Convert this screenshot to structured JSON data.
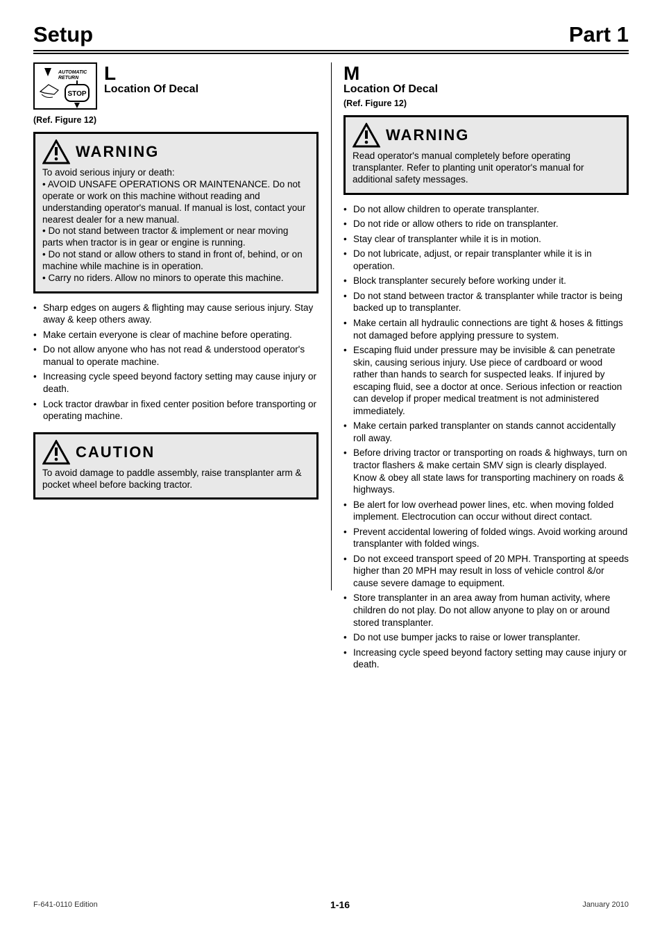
{
  "header": {
    "left": "Setup",
    "right": "Part 1"
  },
  "left_col": {
    "section_title": "L",
    "section_sub": "Location Of Decal",
    "ref": "(Ref. Figure 12)",
    "warn1_title": "WARNING",
    "warn1_body": "To avoid serious injury or death:\n• AVOID UNSAFE OPERATIONS OR MAINTENANCE. Do not operate or work on this machine without reading and understanding operator's manual. If manual is lost, contact your nearest dealer for a new manual.\n• Do not stand between tractor & implement or near moving parts when tractor is in gear or engine is running.\n• Do not stand or allow others to stand in front of, behind, or on machine while machine is in operation.\n• Carry no riders. Allow no minors to operate this machine.",
    "bullet_1": "Sharp edges on augers & flighting may cause serious injury. Stay away & keep others away.",
    "bullet_2": "Make certain everyone is clear of machine before operating.",
    "bullet_3": "Do not allow anyone who has not read & understood operator's manual to operate machine.",
    "bullet_4": "Increasing cycle speed beyond factory setting may cause injury or death.",
    "bullet_5": "Lock tractor drawbar in fixed center position before transporting or operating machine.",
    "warn2_title": "CAUTION",
    "warn2_body": "To avoid damage to paddle assembly, raise transplanter arm & pocket wheel before backing tractor."
  },
  "right_col": {
    "section_title": "M",
    "section_sub": "Location Of Decal",
    "ref": "(Ref. Figure 12)",
    "warn_title": "WARNING",
    "warn_body": "Read operator's manual completely before operating transplanter. Refer to planting unit operator's manual for additional safety messages.",
    "bullets": [
      "Do not allow children to operate transplanter.",
      "Do not ride or allow others to ride on transplanter.",
      "Stay clear of transplanter while it is in motion.",
      "Do not lubricate, adjust, or repair transplanter while it is in operation.",
      "Block transplanter securely before working under it.",
      "Do not stand between tractor & transplanter while tractor is being backed up to transplanter.",
      "Make certain all hydraulic connections are tight & hoses & fittings not damaged before applying pressure to system.",
      "Escaping fluid under pressure may be invisible & can penetrate skin, causing serious injury. Use piece of cardboard or wood rather than hands to search for suspected leaks. If injured by escaping fluid, see a doctor at once. Serious infection or reaction can develop if proper medical treatment is not administered immediately.",
      "Make certain parked transplanter on stands cannot accidentally roll away.",
      "Before driving tractor or transporting on roads & highways, turn on tractor flashers & make certain SMV sign is clearly displayed. Know & obey all state laws for transporting machinery on roads & highways.",
      "Be alert for low overhead power lines, etc. when moving folded implement. Electrocution can occur without direct contact.",
      "Prevent accidental lowering of folded wings. Avoid working around transplanter with folded wings.",
      "Do not exceed transport speed of 20 MPH. Transporting at speeds higher than 20 MPH may result in loss of vehicle control &/or cause severe damage to equipment.",
      "Store transplanter in an area away from human activity, where children do not play. Do not allow anyone to play on or around stored transplanter.",
      "Do not use bumper jacks to raise or lower transplanter.",
      "Increasing cycle speed beyond factory setting may cause injury or death."
    ]
  },
  "footer": {
    "code": "F-641-0110 Edition",
    "page": "1-16",
    "date": "January 2010"
  }
}
